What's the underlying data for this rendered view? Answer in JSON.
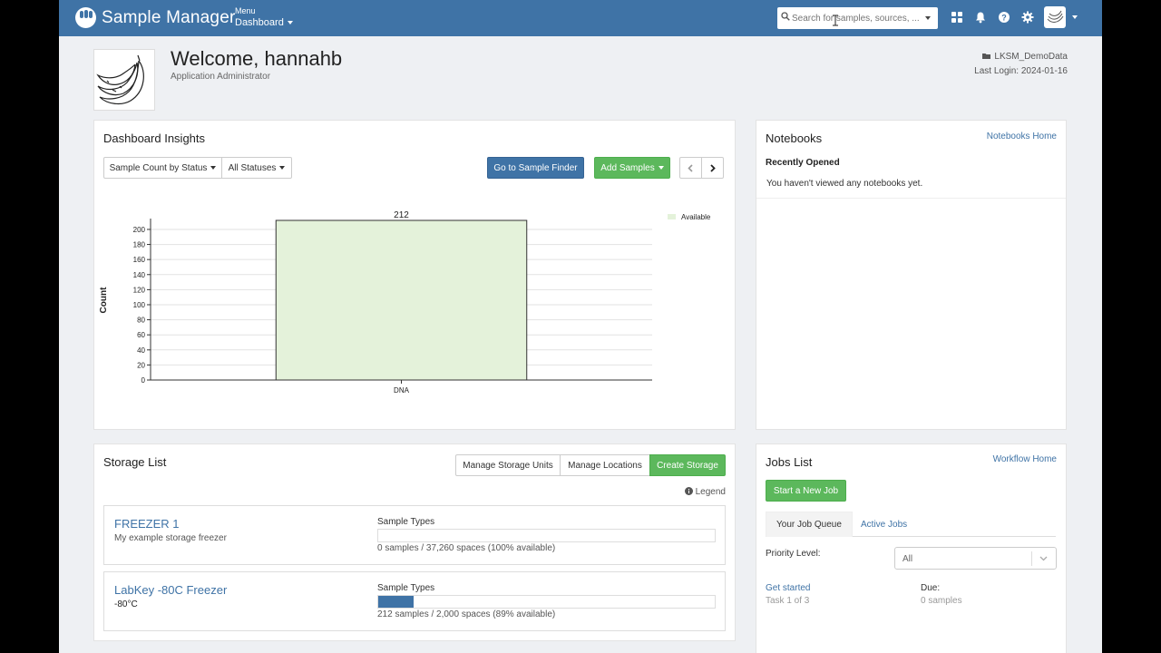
{
  "navbar": {
    "brand": "Sample Manager",
    "menu_top": "Menu",
    "menu_bottom": "Dashboard",
    "search_placeholder": "Search for samples, sources, ...",
    "color": "#3f73a6"
  },
  "header": {
    "welcome": "Welcome, hannahb",
    "role": "Application Administrator",
    "project": "LKSM_DemoData",
    "last_login": "Last Login: 2024-01-16"
  },
  "insights": {
    "title": "Dashboard Insights",
    "chart_select": "Sample Count by Status",
    "status_select": "All Statuses",
    "finder_button": "Go to Sample Finder",
    "add_button": "Add Samples"
  },
  "chart_data": {
    "type": "bar",
    "categories": [
      "DNA"
    ],
    "series": [
      {
        "name": "Available",
        "values": [
          212
        ],
        "color": "#e4f2da"
      }
    ],
    "data_labels": [
      "212"
    ],
    "ylabel": "Count",
    "ylim": [
      0,
      212
    ],
    "yticks": [
      "0",
      "20",
      "40",
      "60",
      "80",
      "100",
      "120",
      "140",
      "160",
      "180",
      "200"
    ],
    "grid": true,
    "legend": "top-right"
  },
  "notebooks": {
    "title": "Notebooks",
    "home_link": "Notebooks Home",
    "subtitle": "Recently Opened",
    "empty": "You haven't viewed any notebooks yet."
  },
  "storage": {
    "title": "Storage List",
    "manage_units": "Manage Storage Units",
    "manage_locations": "Manage Locations",
    "create": "Create Storage",
    "legend": "Legend",
    "items": [
      {
        "name": "FREEZER 1",
        "desc": "My example storage freezer",
        "types_label": "Sample Types",
        "fill": 0.0,
        "caption": "0 samples / 37,260 spaces (100% available)"
      },
      {
        "name": "LabKey -80C Freezer",
        "desc": "-80°C",
        "types_label": "Sample Types",
        "fill": 0.106,
        "caption": "212 samples / 2,000 spaces (89% available)"
      }
    ]
  },
  "jobs": {
    "title": "Jobs List",
    "home_link": "Workflow Home",
    "new_job": "Start a New Job",
    "tabs": [
      "Your Job Queue",
      "Active Jobs"
    ],
    "priority_label": "Priority Level:",
    "priority_value": "All",
    "job_name": "Get started",
    "job_task": "Task 1 of 3",
    "due_label": "Due:",
    "due_value": "0 samples"
  }
}
